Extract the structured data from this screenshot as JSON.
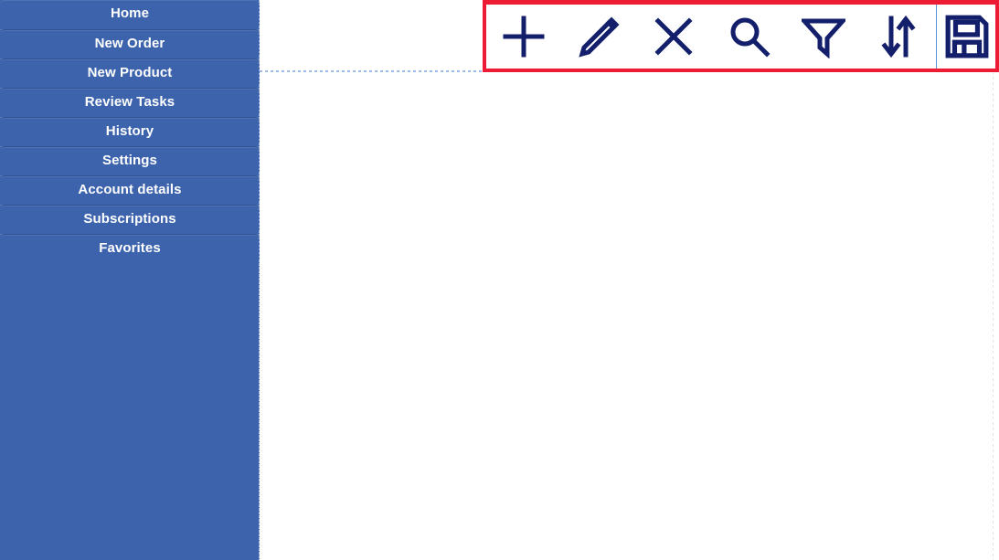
{
  "colors": {
    "sidebar_bg": "#3c63ac",
    "sidebar_text": "#ffffff",
    "icon": "#131f6b",
    "highlight_border": "#ed1b34",
    "divider": "#5b93d6",
    "dotted_rule": "#9dbbe8",
    "content_bg": "#ffffff"
  },
  "sidebar": {
    "items": [
      {
        "label": "Home",
        "name": "sidebar-item-home"
      },
      {
        "label": "New Order",
        "name": "sidebar-item-new-order"
      },
      {
        "label": "New Product",
        "name": "sidebar-item-new-product"
      },
      {
        "label": "Review Tasks",
        "name": "sidebar-item-review-tasks"
      },
      {
        "label": "History",
        "name": "sidebar-item-history"
      },
      {
        "label": "Settings",
        "name": "sidebar-item-settings"
      },
      {
        "label": "Account details",
        "name": "sidebar-item-account-details"
      },
      {
        "label": "Subscriptions",
        "name": "sidebar-item-subscriptions"
      },
      {
        "label": "Favorites",
        "name": "sidebar-item-favorites"
      }
    ]
  },
  "toolbar": {
    "highlighted": true,
    "buttons": [
      {
        "icon": "plus-icon",
        "label": "Add"
      },
      {
        "icon": "pencil-icon",
        "label": "Edit"
      },
      {
        "icon": "close-icon",
        "label": "Delete"
      },
      {
        "icon": "search-icon",
        "label": "Search"
      },
      {
        "icon": "filter-icon",
        "label": "Filter"
      },
      {
        "icon": "sort-icon",
        "label": "Sort"
      },
      {
        "icon": "save-icon",
        "label": "Save"
      }
    ]
  },
  "main": {
    "content": ""
  }
}
